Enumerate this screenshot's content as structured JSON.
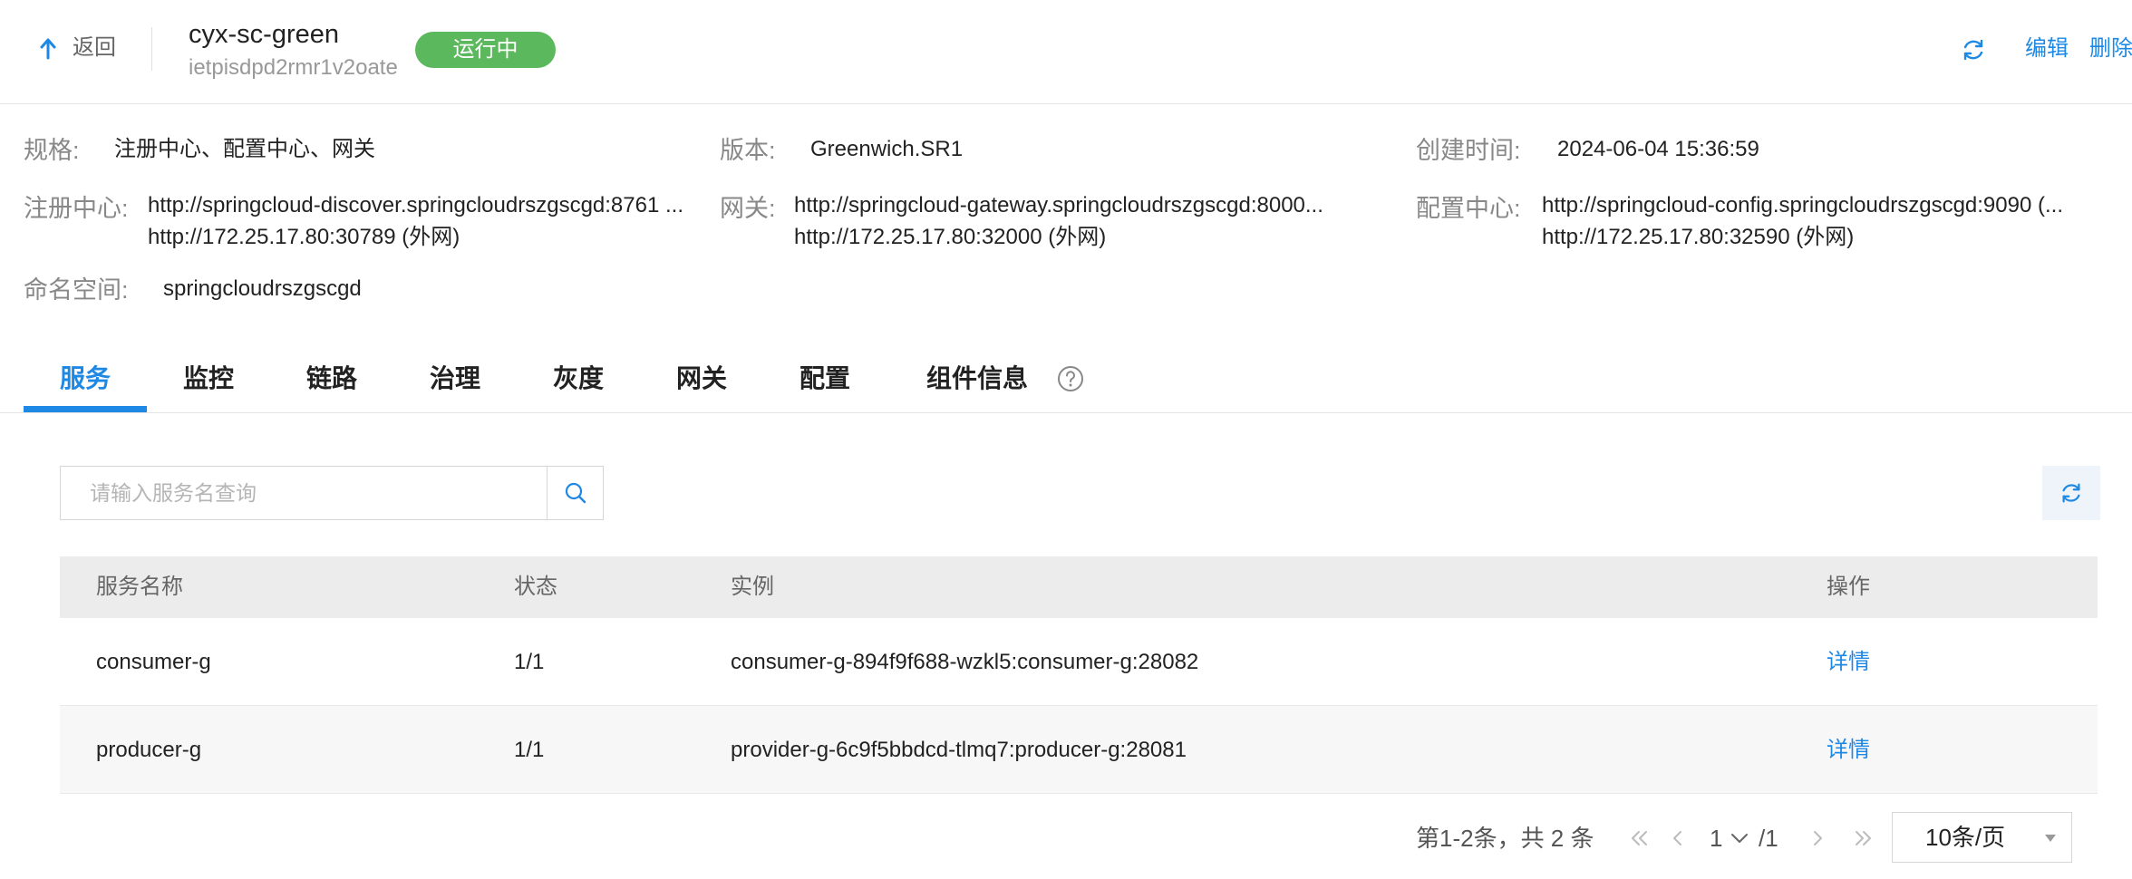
{
  "header": {
    "back_label": "返回",
    "title": "cyx-sc-green",
    "subtitle": "ietpisdpd2rmr1v2oate",
    "status": "运行中",
    "status_color": "#5cb85c",
    "accent_color": "#1e88e5",
    "edit_label": "编辑",
    "delete_label": "删除"
  },
  "info": {
    "spec": {
      "label": "规格:",
      "value": "注册中心、配置中心、网关"
    },
    "version": {
      "label": "版本:",
      "value": "Greenwich.SR1"
    },
    "created": {
      "label": "创建时间:",
      "value": "2024-06-04 15:36:59"
    },
    "registry": {
      "label": "注册中心:",
      "line1": "http://springcloud-discover.springcloudrszgscgd:8761 ...",
      "line2": "http://172.25.17.80:30789 (外网)"
    },
    "gateway": {
      "label": "网关:",
      "line1": "http://springcloud-gateway.springcloudrszgscgd:8000...",
      "line2": "http://172.25.17.80:32000 (外网)"
    },
    "config": {
      "label": "配置中心:",
      "line1": "http://springcloud-config.springcloudrszgscgd:9090 (...",
      "line2": "http://172.25.17.80:32590 (外网)"
    },
    "namespace": {
      "label": "命名空间:",
      "value": "springcloudrszgscgd"
    }
  },
  "tabs": [
    {
      "label": "服务",
      "active": true
    },
    {
      "label": "监控",
      "active": false
    },
    {
      "label": "链路",
      "active": false
    },
    {
      "label": "治理",
      "active": false
    },
    {
      "label": "灰度",
      "active": false
    },
    {
      "label": "网关",
      "active": false
    },
    {
      "label": "配置",
      "active": false
    },
    {
      "label": "组件信息",
      "active": false
    }
  ],
  "search": {
    "placeholder": "请输入服务名查询",
    "value": ""
  },
  "table": {
    "headers": [
      "服务名称",
      "状态",
      "实例",
      "操作"
    ],
    "rows": [
      {
        "name": "consumer-g",
        "status": "1/1",
        "instance": "consumer-g-894f9f688-wzkl5:consumer-g:28082",
        "action": "详情"
      },
      {
        "name": "producer-g",
        "status": "1/1",
        "instance": "provider-g-6c9f5bbdcd-tlmq7:producer-g:28081",
        "action": "详情"
      }
    ]
  },
  "pagination": {
    "total_text": "第1-2条，共 2 条",
    "current": "1",
    "of_text": "/1",
    "page_size": "10条/页"
  }
}
